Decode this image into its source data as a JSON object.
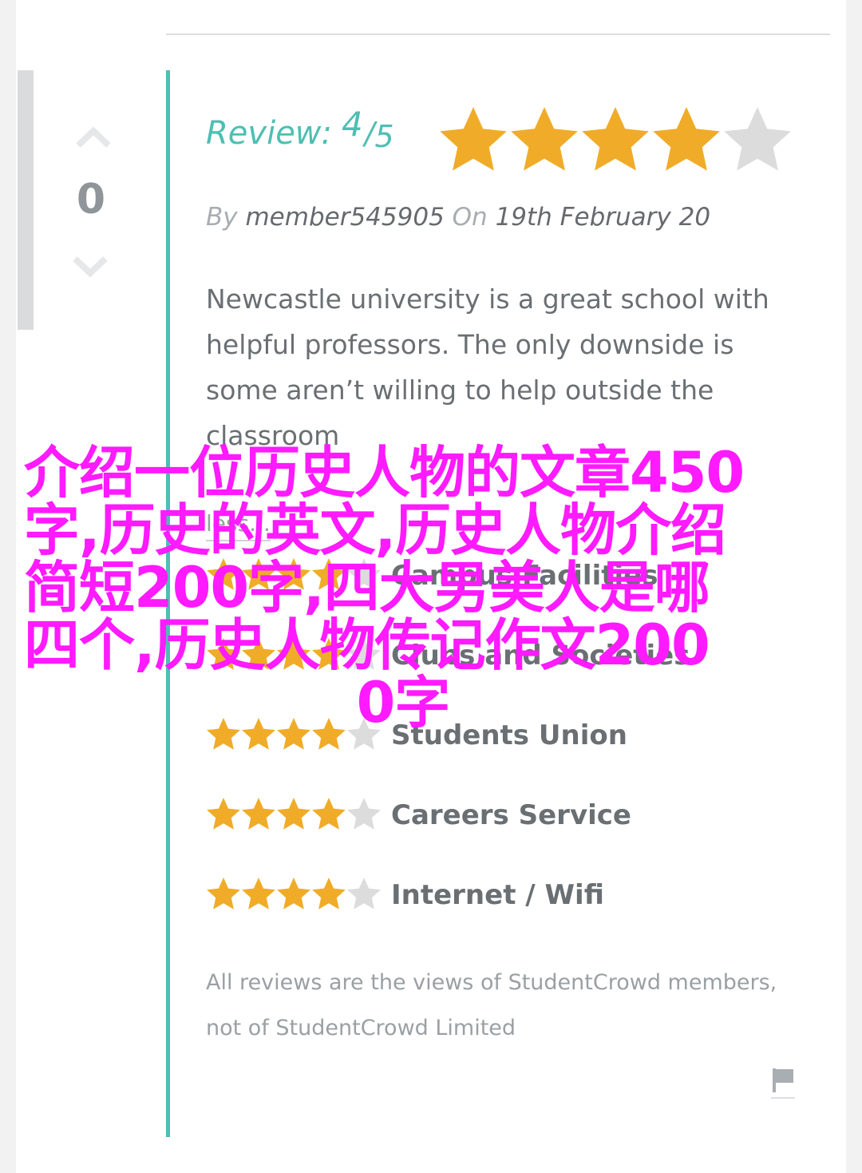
{
  "vote": {
    "count": "0"
  },
  "review": {
    "label": "Review:",
    "score": "4",
    "slash": "/",
    "out_of": "5",
    "rating": 4,
    "max_rating": 5
  },
  "byline": {
    "by": "By",
    "author": "member545905",
    "on": "On",
    "date": "19th February 20"
  },
  "body": {
    "text": "Newcastle university is a great school with helpful professors. The only downside is some aren’t willing to help outside the classroom"
  },
  "read_more": "less...",
  "ratings": [
    {
      "label": "Campus Facilities",
      "rating": 4,
      "max": 5
    },
    {
      "label": "Clubs and Societies",
      "rating": 4,
      "max": 5
    },
    {
      "label": "Students Union",
      "rating": 4,
      "max": 5
    },
    {
      "label": "Careers Service",
      "rating": 4,
      "max": 5
    },
    {
      "label": "Internet / Wifi",
      "rating": 4,
      "max": 5
    }
  ],
  "disclaimer": "All reviews are the views of StudentCrowd members, not of StudentCrowd Limited",
  "overlay": {
    "line1": "介绍一位历史人物的文章450",
    "line2": "字,历史的英文,历史人物介绍",
    "line3": "简短200字,四大男美人是哪",
    "line4": "四个,历史人物传记作文200",
    "line5": "0字"
  },
  "colors": {
    "accent_teal": "#4dbfb3",
    "star_filled": "#f0ac28",
    "star_empty": "#dcdcdc",
    "overlay_magenta": "#ff1aff"
  },
  "icons": {
    "vote_up": "chevron-up-icon",
    "vote_down": "chevron-down-icon",
    "star": "star-icon",
    "flag": "flag-icon"
  }
}
